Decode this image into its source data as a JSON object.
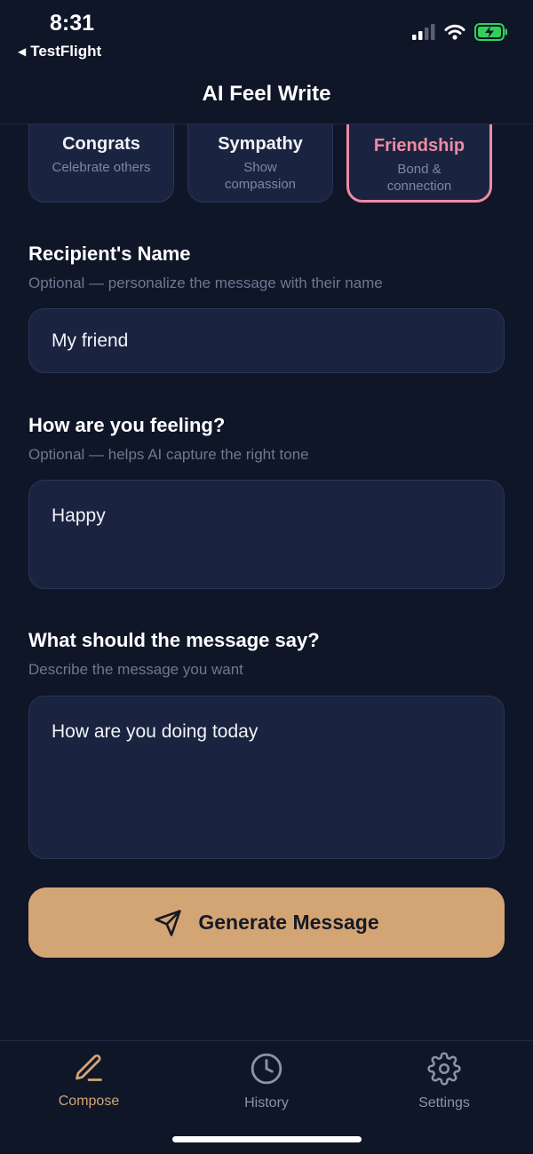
{
  "status": {
    "time": "8:31",
    "back_app": "TestFlight"
  },
  "header": {
    "title": "AI Feel Write"
  },
  "categories": [
    {
      "title": "Congrats",
      "subtitle": "Celebrate others",
      "selected": false
    },
    {
      "title": "Sympathy",
      "subtitle": "Show compassion",
      "selected": false
    },
    {
      "title": "Friendship",
      "subtitle": "Bond & connection",
      "selected": true
    }
  ],
  "form": {
    "recipient": {
      "label": "Recipient's Name",
      "hint": "Optional — personalize the message with their name",
      "value": "My friend"
    },
    "feeling": {
      "label": "How are you feeling?",
      "hint": "Optional — helps AI capture the right tone",
      "value": "Happy"
    },
    "message": {
      "label": "What should the message say?",
      "hint": "Describe the message you want",
      "value": "How are you doing today"
    }
  },
  "generate_button": {
    "label": "Generate Message",
    "icon": "send-icon"
  },
  "tabs": [
    {
      "label": "Compose",
      "icon": "pencil-icon",
      "active": true
    },
    {
      "label": "History",
      "icon": "clock-icon",
      "active": false
    },
    {
      "label": "Settings",
      "icon": "gear-icon",
      "active": false
    }
  ],
  "colors": {
    "background": "#0e1628",
    "card": "#1a2440",
    "accent": "#d4a574",
    "selected": "#f08aa4"
  }
}
